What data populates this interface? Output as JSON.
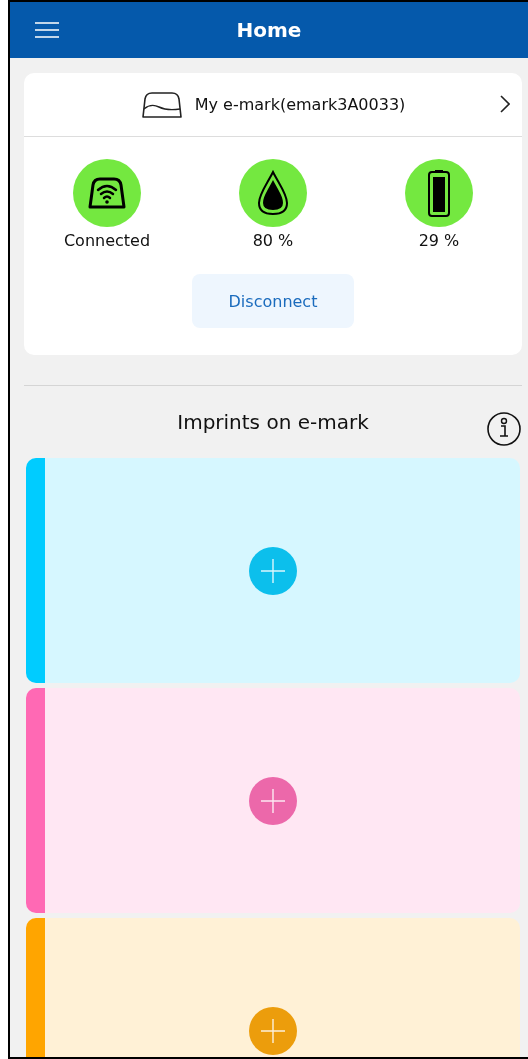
{
  "app_bar": {
    "title": "Home"
  },
  "device": {
    "name": "My e-mark(emark3A0033)"
  },
  "status": [
    {
      "kind": "connection",
      "label": "Connected"
    },
    {
      "kind": "ink",
      "label": "80 %"
    },
    {
      "kind": "battery",
      "label": "29 %"
    }
  ],
  "disconnect_button": "Disconnect",
  "imprints": {
    "title": "Imprints on e-mark",
    "slots": [
      {
        "color": "#00ccff"
      },
      {
        "color": "#ff69b4"
      },
      {
        "color": "#ffa500"
      }
    ]
  }
}
